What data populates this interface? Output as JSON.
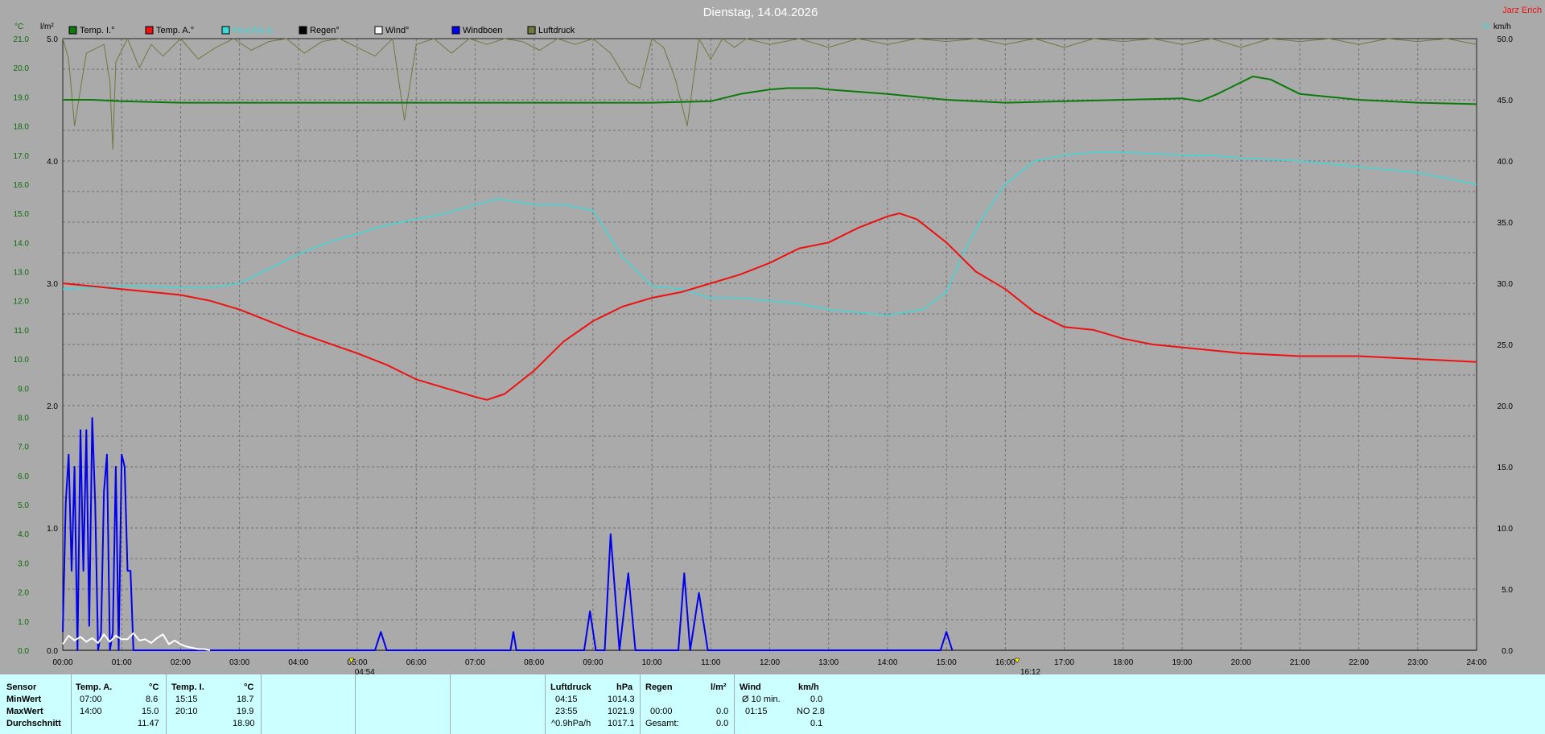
{
  "header": {
    "title": "Dienstag, 14.04.2026",
    "owner": "Jarz Erich"
  },
  "colors": {
    "temp_in": "#0b7a0b",
    "temp_out": "#ee1111",
    "humidity": "#3fd8d8",
    "rain": "#000000",
    "wind": "#ffffff",
    "gusts": "#0000ee",
    "pressure": "#6e7a3e",
    "background": "#aaaaaa",
    "grid": "#707070",
    "table_bg": "#ccffff"
  },
  "chart_data": {
    "type": "line",
    "title": "Dienstag, 14.04.2026",
    "left_axis_temp": {
      "unit": "°C",
      "ylim": [
        0,
        21
      ],
      "ticks": [
        "0.0",
        "1.0",
        "2.0",
        "3.0",
        "4.0",
        "5.0",
        "6.0",
        "7.0",
        "8.0",
        "9.0",
        "10.0",
        "11.0",
        "12.0",
        "13.0",
        "14.0",
        "15.0",
        "16.0",
        "17.0",
        "18.0",
        "19.0",
        "20.0",
        "21.0"
      ]
    },
    "left_axis_rain": {
      "unit": "l/m²",
      "ylim": [
        0,
        5
      ],
      "ticks": [
        "0.0",
        "1.0",
        "2.0",
        "3.0",
        "4.0",
        "5.0"
      ]
    },
    "right_axis_wind": {
      "unit": "km/h",
      "ylim": [
        0,
        50
      ],
      "ticks": [
        "0.0",
        "5.0",
        "10.0",
        "15.0",
        "20.0",
        "25.0",
        "30.0",
        "35.0",
        "40.0",
        "45.0",
        "50.0"
      ]
    },
    "right_axis_humidity": {
      "unit": "%"
    },
    "x_ticks": [
      "00:00",
      "01:00",
      "02:00",
      "03:00",
      "04:00",
      "05:00",
      "06:00",
      "07:00",
      "08:00",
      "09:00",
      "10:00",
      "11:00",
      "12:00",
      "13:00",
      "14:00",
      "15:00",
      "16:00",
      "17:00",
      "18:00",
      "19:00",
      "20:00",
      "21:00",
      "22:00",
      "23:00",
      "24:00"
    ],
    "markers": [
      {
        "time": 4.9,
        "label": "04:54"
      },
      {
        "time": 16.2,
        "label": "16:12"
      }
    ],
    "grid": true,
    "legend_position": "top",
    "legend": [
      "Temp. I.°",
      "Temp. A.°",
      "Feuchte A.",
      "Regen°",
      "Wind°",
      "Windboen",
      "Luftdruck"
    ],
    "series": [
      {
        "name": "Temp. I.°",
        "axis": "temp",
        "x": [
          0,
          0.5,
          1,
          2,
          4,
          6,
          8,
          10,
          11,
          11.5,
          12,
          12.3,
          12.8,
          13,
          14,
          14.5,
          15,
          16,
          17,
          18,
          19,
          19.3,
          19.6,
          20,
          20.2,
          20.5,
          21,
          22,
          23,
          24
        ],
        "y": [
          18.9,
          18.9,
          18.85,
          18.8,
          18.8,
          18.8,
          18.8,
          18.8,
          18.85,
          19.1,
          19.25,
          19.3,
          19.3,
          19.25,
          19.1,
          19.0,
          18.9,
          18.8,
          18.85,
          18.9,
          18.95,
          18.85,
          19.1,
          19.5,
          19.7,
          19.6,
          19.1,
          18.9,
          18.8,
          18.75
        ]
      },
      {
        "name": "Temp. A.°",
        "axis": "temp",
        "x": [
          0,
          0.5,
          1,
          1.5,
          2,
          2.5,
          3,
          4,
          5,
          5.5,
          6,
          6.5,
          7,
          7.2,
          7.5,
          8,
          8.5,
          9,
          9.5,
          10,
          10.5,
          11,
          11.5,
          12,
          12.5,
          13,
          13.5,
          14,
          14.2,
          14.5,
          15,
          15.5,
          16,
          16.5,
          17,
          17.5,
          18,
          18.5,
          19,
          19.5,
          20,
          21,
          22,
          23,
          24
        ],
        "y": [
          12.6,
          12.5,
          12.4,
          12.3,
          12.2,
          12.0,
          11.7,
          10.9,
          10.2,
          9.8,
          9.3,
          9.0,
          8.7,
          8.6,
          8.8,
          9.6,
          10.6,
          11.3,
          11.8,
          12.1,
          12.3,
          12.6,
          12.9,
          13.3,
          13.8,
          14.0,
          14.5,
          14.9,
          15.0,
          14.8,
          14.0,
          13.0,
          12.4,
          11.6,
          11.1,
          11.0,
          10.7,
          10.5,
          10.4,
          10.3,
          10.2,
          10.1,
          10.1,
          10.0,
          9.9
        ]
      },
      {
        "name": "Feuchte A.",
        "axis": "temp",
        "x": [
          0,
          0.5,
          1,
          1.5,
          2,
          2.5,
          3,
          3.5,
          4,
          4.5,
          5,
          5.5,
          6,
          6.5,
          7,
          7.4,
          7.7,
          8,
          8.5,
          9,
          9.5,
          10,
          10.5,
          11,
          11.5,
          12,
          12.5,
          13,
          13.5,
          14,
          14.3,
          14.6,
          15,
          15.3,
          15.6,
          16,
          16.5,
          17,
          17.5,
          18,
          18.5,
          19,
          19.5,
          20,
          21,
          22,
          23,
          24
        ],
        "y": [
          12.4,
          12.45,
          12.5,
          12.5,
          12.45,
          12.45,
          12.6,
          13.1,
          13.6,
          14.0,
          14.3,
          14.6,
          14.8,
          15.0,
          15.3,
          15.5,
          15.4,
          15.3,
          15.3,
          15.1,
          13.5,
          12.5,
          12.4,
          12.1,
          12.1,
          12.0,
          11.9,
          11.7,
          11.6,
          11.5,
          11.6,
          11.7,
          12.3,
          13.7,
          14.8,
          16.0,
          16.8,
          17.0,
          17.1,
          17.1,
          17.05,
          17.0,
          17.0,
          16.9,
          16.8,
          16.6,
          16.4,
          16.0
        ]
      },
      {
        "name": "Luftdruck",
        "axis": "temp",
        "x": [
          0,
          0.1,
          0.2,
          0.4,
          0.7,
          0.8,
          0.85,
          0.9,
          1.1,
          1.3,
          1.5,
          1.7,
          2,
          2.3,
          2.6,
          2.9,
          3.2,
          3.5,
          3.8,
          4.1,
          4.4,
          4.7,
          5,
          5.3,
          5.6,
          5.8,
          6,
          6.3,
          6.6,
          6.9,
          7.2,
          7.5,
          7.8,
          8.1,
          8.4,
          8.7,
          9,
          9.3,
          9.6,
          9.8,
          10,
          10.2,
          10.4,
          10.6,
          10.8,
          11,
          11.2,
          11.4,
          11.6,
          12,
          12.5,
          13,
          13.5,
          14,
          14.5,
          15,
          15.5,
          16,
          16.5,
          17,
          17.5,
          18,
          18.5,
          19,
          19.5,
          20,
          20.5,
          21,
          21.5,
          22,
          22.5,
          23,
          23.5,
          24
        ],
        "y": [
          21,
          20.3,
          18.0,
          20.5,
          20.8,
          19.5,
          17.2,
          20.2,
          21,
          20.0,
          20.8,
          20.4,
          21,
          20.3,
          20.7,
          21,
          20.6,
          20.9,
          21,
          20.5,
          20.9,
          21,
          20.7,
          20.4,
          21,
          18.2,
          20.8,
          21,
          20.5,
          21,
          20.8,
          21,
          20.9,
          20.6,
          21,
          20.8,
          21,
          20.5,
          19.5,
          19.3,
          21,
          20.7,
          19.6,
          18.0,
          21,
          20.3,
          21,
          20.7,
          21,
          20.8,
          21,
          20.7,
          21,
          20.8,
          21,
          20.9,
          21,
          20.8,
          21,
          20.7,
          21,
          20.9,
          21,
          20.8,
          21,
          20.7,
          21,
          20.9,
          21,
          20.8,
          21,
          20.9,
          21,
          20.8
        ]
      },
      {
        "name": "Windboen",
        "axis": "wind",
        "x": [
          0,
          0.05,
          0.1,
          0.15,
          0.2,
          0.25,
          0.3,
          0.35,
          0.4,
          0.45,
          0.5,
          0.55,
          0.6,
          0.65,
          0.7,
          0.75,
          0.8,
          0.85,
          0.9,
          0.95,
          1.0,
          1.05,
          1.1,
          1.15,
          1.2,
          1.25,
          1.3,
          1.35,
          1.4,
          1.45,
          1.5,
          1.55,
          1.6,
          1.65,
          1.7,
          1.75,
          1.8,
          1.85,
          1.9,
          1.95,
          2.0,
          5.3,
          5.4,
          5.5,
          7.6,
          7.65,
          7.7,
          8.85,
          8.95,
          9.05,
          9.2,
          9.3,
          9.45,
          9.6,
          9.72,
          9.85,
          10.45,
          10.55,
          10.65,
          10.8,
          10.95,
          11.1,
          11.25,
          14.9,
          15.0,
          15.1
        ],
        "y": [
          1.5,
          12,
          16,
          6.5,
          15,
          0,
          18,
          6.5,
          18,
          2,
          19,
          12,
          0,
          1.5,
          13,
          16,
          0,
          1.5,
          15,
          0,
          16,
          15,
          6.5,
          6.5,
          0,
          0,
          0,
          0,
          0,
          0,
          0,
          0,
          0,
          0,
          0,
          0,
          0,
          0,
          0,
          0,
          0,
          0,
          1.5,
          0,
          0,
          1.5,
          0,
          0,
          3.2,
          0,
          0,
          9.5,
          0,
          6.3,
          0,
          0,
          0,
          6.3,
          0,
          4.7,
          0,
          0,
          0,
          0,
          1.5,
          0
        ]
      },
      {
        "name": "Wind°",
        "axis": "wind",
        "x": [
          0,
          0.1,
          0.2,
          0.3,
          0.4,
          0.5,
          0.6,
          0.7,
          0.8,
          0.9,
          1.0,
          1.1,
          1.2,
          1.3,
          1.4,
          1.5,
          1.6,
          1.7,
          1.8,
          1.9,
          2.0,
          2.1,
          2.2,
          2.3,
          2.4,
          2.5
        ],
        "y": [
          0.5,
          1.2,
          0.8,
          1.1,
          0.7,
          1.0,
          0.6,
          1.3,
          0.7,
          1.2,
          0.9,
          0.9,
          1.4,
          0.8,
          0.9,
          0.6,
          1.0,
          1.3,
          0.5,
          0.8,
          0.5,
          0.3,
          0.2,
          0.1,
          0.1,
          0
        ]
      },
      {
        "name": "Regen°",
        "axis": "rain",
        "x": [
          0,
          24
        ],
        "y": [
          0,
          0
        ]
      }
    ]
  },
  "table": {
    "row_labels": [
      "Sensor",
      "MinWert",
      "MaxWert",
      "Durchschnitt"
    ],
    "temp_a": {
      "header": "Temp. A.",
      "unit": "°C",
      "min_time": "07:00",
      "min": "8.6",
      "max_time": "14:00",
      "max": "15.0",
      "avg": "11.47"
    },
    "temp_i": {
      "header": "Temp. I.",
      "unit": "°C",
      "min_time": "15:15",
      "min": "18.7",
      "max_time": "20:10",
      "max": "19.9",
      "avg": "18.90"
    },
    "pressure": {
      "header": "Luftdruck",
      "unit": "hPa",
      "min_time": "04:15",
      "min": "1014.3",
      "max_time": "23:55",
      "max": "1021.9",
      "trend": "^0.9hPa/h",
      "avg": "1017.1"
    },
    "rain": {
      "header": "Regen",
      "unit": "l/m²",
      "time": "00:00",
      "value": "0.0",
      "total_label": "Gesamt:",
      "total": "0.0"
    },
    "wind": {
      "header": "Wind",
      "unit": "km/h",
      "avg10_label": "Ø 10 min.",
      "avg10": "0.0",
      "max_time": "01:15",
      "max": "NO 2.8",
      "avg": "0.1"
    }
  }
}
